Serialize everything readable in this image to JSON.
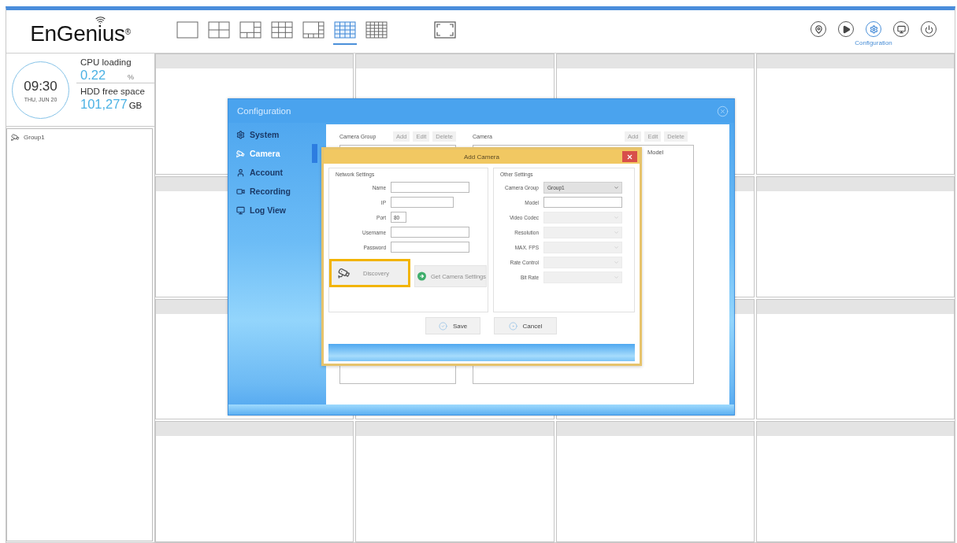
{
  "header": {
    "logo": "EnGenius$^{®}$",
    "layouts": [
      {
        "kind": "single",
        "selected": false
      },
      {
        "kind": "quad",
        "selected": false
      },
      {
        "kind": "six",
        "selected": false
      },
      {
        "kind": "nine",
        "selected": false
      },
      {
        "kind": "eight",
        "selected": false
      },
      {
        "kind": "sixteen",
        "selected": true
      },
      {
        "kind": "twentyfive",
        "selected": false
      }
    ],
    "toolbar": [
      {
        "kind": "location",
        "selected": false
      },
      {
        "kind": "playback",
        "selected": false
      },
      {
        "kind": "configuration",
        "selected": true,
        "label": "Configuration"
      },
      {
        "kind": "monitor",
        "selected": false
      },
      {
        "kind": "power",
        "selected": false
      }
    ]
  },
  "status": {
    "clock": {
      "time": "09:30",
      "date": "THU, JUN 20"
    },
    "stats": [
      {
        "label": "CPU loading",
        "value": "0.22",
        "unit": "%"
      },
      {
        "label": "HDD free space",
        "value": "101,277",
        "unit": "GB"
      }
    ]
  },
  "group_tree": [
    {
      "label": "Group1"
    }
  ],
  "configuration": {
    "title": "Configuration",
    "menu": [
      {
        "label": "System",
        "kind": "system",
        "selected": false
      },
      {
        "label": "Camera",
        "kind": "camera",
        "selected": true
      },
      {
        "label": "Account",
        "kind": "account",
        "selected": false
      },
      {
        "label": "Recording",
        "kind": "recording",
        "selected": false
      },
      {
        "label": "Log View",
        "kind": "log",
        "selected": false
      }
    ],
    "camera_group": {
      "title": "Camera Group",
      "buttons": [
        "Add",
        "Edit",
        "Delete"
      ]
    },
    "camera": {
      "title": "Camera",
      "buttons": [
        "Add",
        "Edit",
        "Delete"
      ],
      "columns": [
        "Model"
      ]
    }
  },
  "add_camera": {
    "title": "Add Camera",
    "network_settings": {
      "title": "Network Settings",
      "fields": [
        {
          "label": "Name",
          "kind": "text"
        },
        {
          "label": "IP",
          "kind": "ip"
        },
        {
          "label": "Port",
          "kind": "port",
          "value": "80"
        },
        {
          "label": "Username",
          "kind": "text"
        },
        {
          "label": "Password",
          "kind": "text"
        }
      ],
      "buttons": [
        {
          "label": "Discovery",
          "kind": "discovery",
          "highlighted": true
        },
        {
          "label": "Get Camera Settings",
          "kind": "fetch",
          "highlighted": false
        }
      ]
    },
    "other_settings": {
      "title": "Other Settings",
      "fields": [
        {
          "label": "Camera Group",
          "kind": "select",
          "value": "Group1",
          "disabled": false
        },
        {
          "label": "Model",
          "kind": "text",
          "disabled": false
        },
        {
          "label": "Video Codec",
          "kind": "select",
          "disabled": true
        },
        {
          "label": "Resolution",
          "kind": "select",
          "disabled": true
        },
        {
          "label": "MAX. FPS",
          "kind": "select",
          "disabled": true
        },
        {
          "label": "Rate Control",
          "kind": "select",
          "disabled": true
        },
        {
          "label": "Bit Rate",
          "kind": "select",
          "disabled": true
        }
      ]
    },
    "actions": [
      {
        "label": "Save",
        "kind": "save"
      },
      {
        "label": "Cancel",
        "kind": "cancel"
      }
    ]
  }
}
